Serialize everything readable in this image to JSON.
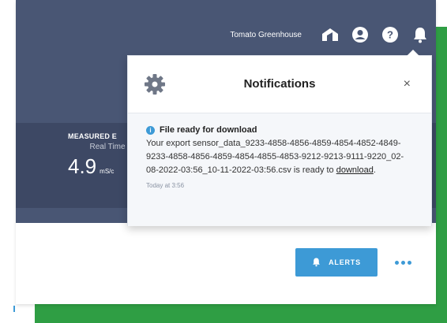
{
  "header": {
    "greenhouse_name": "Tomato Greenhouse",
    "icons": [
      "greenhouse-icon",
      "user-icon",
      "help-icon",
      "bell-icon"
    ]
  },
  "measure": {
    "title": "MEASURED E",
    "subtitle": "Real Time",
    "value": "4.9",
    "unit": "mS/c"
  },
  "notifications": {
    "title": "Notifications",
    "close_label": "×",
    "item": {
      "title": "File ready for download",
      "text_before": "Your export sensor_data_9233-4858-4856-4859-4854-4852-4849-9233-4858-4856-4859-4854-4855-4853-9212-9213-9111-9220_02-08-2022-03:56_10-11-2022-03:56.csv is ready to ",
      "link": "download",
      "text_after": ".",
      "time": "Today at 3:56"
    }
  },
  "actions": {
    "alerts_label": "ALERTS"
  },
  "colors": {
    "header": "#495674",
    "band": "#3d4864",
    "accent": "#3d9ad6",
    "green": "#2f9e44"
  }
}
